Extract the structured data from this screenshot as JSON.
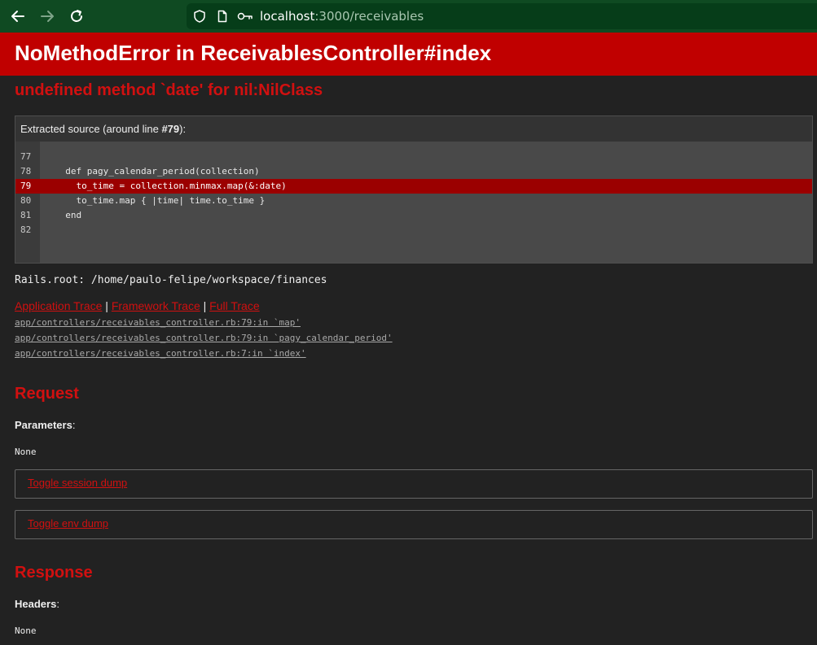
{
  "browser": {
    "url_host": "localhost",
    "url_path": ":3000/receivables",
    "icons": [
      "back-arrow-icon",
      "forward-arrow-icon",
      "reload-icon",
      "shield-icon",
      "page-icon",
      "key-icon"
    ]
  },
  "error": {
    "title": "NoMethodError in ReceivablesController#index",
    "message": "undefined method `date' for nil:NilClass"
  },
  "source": {
    "header_prefix": "Extracted source (around line ",
    "header_line": "#79",
    "header_suffix": "):",
    "lines": [
      {
        "num": "77",
        "code": ""
      },
      {
        "num": "78",
        "code": "  def pagy_calendar_period(collection)"
      },
      {
        "num": "79",
        "code": "    to_time = collection.minmax.map(&:date)",
        "highlighted": true
      },
      {
        "num": "80",
        "code": "    to_time.map { |time| time.to_time }"
      },
      {
        "num": "81",
        "code": "  end"
      },
      {
        "num": "82",
        "code": ""
      }
    ]
  },
  "rails_root": "Rails.root: /home/paulo-felipe/workspace/finances",
  "trace": {
    "links": [
      "Application Trace",
      "Framework Trace",
      "Full Trace"
    ],
    "separator": "|",
    "lines": [
      "app/controllers/receivables_controller.rb:79:in `map'",
      "app/controllers/receivables_controller.rb:79:in `pagy_calendar_period'",
      "app/controllers/receivables_controller.rb:7:in `index'"
    ]
  },
  "request": {
    "title": "Request",
    "params_label": "Parameters",
    "params_colon": ":",
    "params_value": "None",
    "toggle_session": "Toggle session dump",
    "toggle_env": "Toggle env dump"
  },
  "response": {
    "title": "Response",
    "headers_label": "Headers",
    "headers_colon": ":",
    "headers_value": "None"
  },
  "colors": {
    "toolbar": "#0f4a22",
    "error_red": "#c00000",
    "accent_red": "#d11010",
    "background": "#222222"
  }
}
